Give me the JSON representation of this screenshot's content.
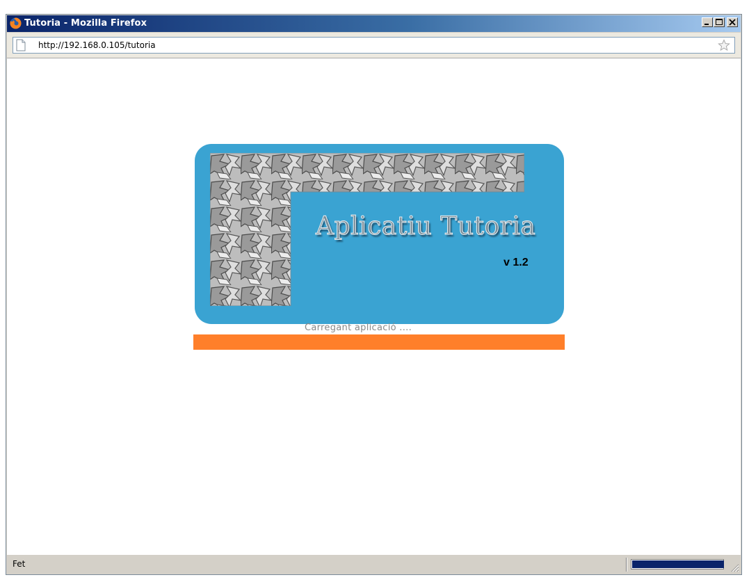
{
  "window": {
    "title": "Tutoria - Mozilla Firefox",
    "controls": {
      "minimize": "minimize-icon",
      "maximize": "maximize-icon",
      "close": "close-icon"
    }
  },
  "urlbar": {
    "url": "http://192.168.0.105/tutoria",
    "page_icon": "page-icon",
    "bookmark_icon": "star-icon"
  },
  "splash": {
    "app_title": "Aplicatiu Tutoria",
    "version": "v 1.2",
    "background_color": "#3aa3d2"
  },
  "loading": {
    "text": "Carregant aplicació ....",
    "bar_color": "#ff7f2a"
  },
  "statusbar": {
    "text": "Fet",
    "progress_fraction": 1.0
  }
}
